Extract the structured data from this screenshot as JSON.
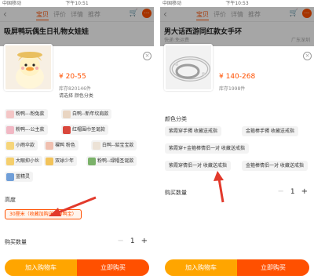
{
  "common": {
    "carrier": "中国移动",
    "tabs": [
      "宝贝",
      "评价",
      "详情",
      "推荐"
    ],
    "qty_label": "购买数量",
    "qty_value": "1",
    "minus": "−",
    "plus": "+",
    "add_to_cart": "加入购物车",
    "buy_now": "立即购买",
    "choose_hint": "请选择 颜色分类",
    "close": "×",
    "back": "‹",
    "more": "···",
    "cart_icon": "🛒"
  },
  "left": {
    "time": "下午10:51",
    "battery": "",
    "bg_title": "吸屏鸭玩偶生日礼物女娃娃",
    "bg_sub_left": "",
    "bg_sub_right": "",
    "price": "¥ 20-55",
    "stock": "库存820146件",
    "colors": [
      {
        "label": "粉鸭---粉兔款",
        "swatch": "#f4c6c6"
      },
      {
        "label": "白鸭--新年坎肩款",
        "swatch": "#e9d5c2"
      },
      {
        "label": "粉鸭---公主款",
        "swatch": "#f1b8c4"
      },
      {
        "label": "红帽围巾圣诞款",
        "swatch": "#d9473c"
      },
      {
        "label": "小雨伞款",
        "swatch": "#f6d57a"
      },
      {
        "label": "裸鸭 粉色",
        "swatch": "#f0c0b0"
      },
      {
        "label": "白鸭--貂宝宝款",
        "swatch": "#ece2d6"
      },
      {
        "label": "大眼抑小伙",
        "swatch": "#f5cf6d"
      },
      {
        "label": "双球少年",
        "swatch": "#f2c35a"
      },
      {
        "label": "粉鸭--绿帽圣诞款",
        "swatch": "#7bb26a"
      },
      {
        "label": "蓝精灵",
        "swatch": "#6f9ed8"
      }
    ],
    "height_label": "高度",
    "height_option": "30厘米（收藏加购送吸屏鸭宝）"
  },
  "right": {
    "time": "下午10:53",
    "battery": "",
    "bg_title": "男大话西游同红款女手环",
    "bg_sub_left": "快递:免运费",
    "bg_sub_right": "广东深圳",
    "price": "¥ 140-268",
    "stock": "库存1998件",
    "color_label": "颜色分类",
    "options": [
      "紫霞穿手镯 收藏送戒指",
      "金箍棒手镯 收藏送戒指",
      "紫霞穿+金箍棒情侣一对 收藏送戒指",
      "紫霞穿情侣一对 收藏送戒指",
      "金箍棒情侣一对 收藏送戒指"
    ]
  },
  "colors": {
    "accent": "#ff5000",
    "cart_button": "#ffa500",
    "arrow": "#e23a2c"
  }
}
